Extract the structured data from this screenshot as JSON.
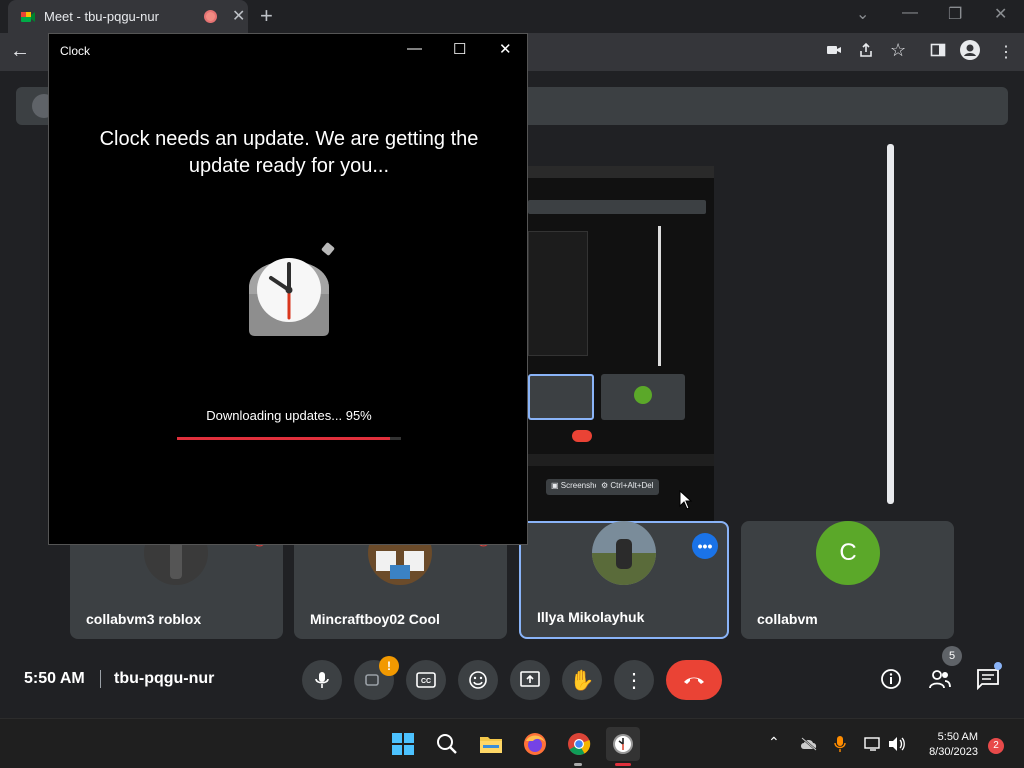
{
  "browser": {
    "tab_title": "Meet - tbu-pqgu-nur",
    "tab_close": "✕",
    "new_tab": "+",
    "win_min": "—",
    "win_max": "❐",
    "win_close": "✕",
    "win_dropdown": "⌄"
  },
  "clock_dialog": {
    "title": "Clock",
    "minimize": "—",
    "maximize": "☐",
    "close": "✕",
    "message": "Clock needs an update. We are getting the update ready for you...",
    "download_text": "Downloading updates... 95%",
    "progress": 0.95
  },
  "meet": {
    "participants": [
      {
        "name": "collabvm3 roblox"
      },
      {
        "name": "Mincraftboy02 Cool"
      },
      {
        "name": "Illya Mikolayhuk"
      },
      {
        "name": "collabvm",
        "initial": "C"
      }
    ],
    "time": "5:50 AM",
    "meeting_code": "tbu-pqgu-nur",
    "people_count": "5",
    "chat_badge": "",
    "camera_alert": "!"
  },
  "taskbar": {
    "time": "5:50 AM",
    "date": "8/30/2023",
    "notification_count": "2"
  },
  "colors": {
    "accent": "#8ab4f8",
    "hangup": "#ea4335",
    "progress": "#e0303c",
    "avatar_green": "#5ba829"
  }
}
